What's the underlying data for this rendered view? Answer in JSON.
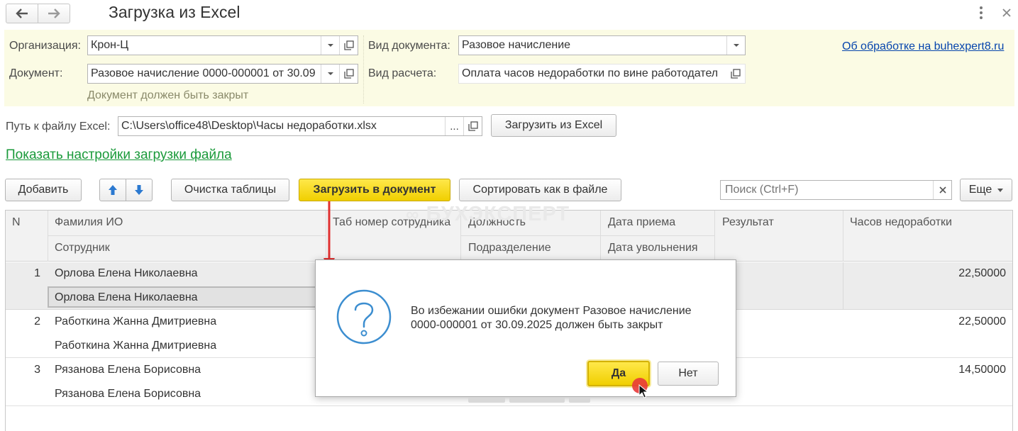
{
  "window": {
    "title": "Загрузка из Excel"
  },
  "form": {
    "org_label": "Организация:",
    "org_value": "Крон-Ц",
    "doc_label": "Документ:",
    "doc_value": "Разовое начисление 0000-000001 от 30.09",
    "doc_hint": "Документ должен быть закрыт",
    "doctype_label": "Вид документа:",
    "doctype_value": "Разовое начисление",
    "calc_label": "Вид расчета:",
    "calc_value": "Оплата часов недоработки по вине работодател",
    "about_link": "Об обработке на buhexpert8.ru"
  },
  "file": {
    "path_label": "Путь к файлу Excel:",
    "path_value": "C:\\Users\\office48\\Desktop\\Часы недоработки.xlsx",
    "ellipsis": "...",
    "load_button": "Загрузить из Excel",
    "settings_link": "Показать настройки загрузки файла"
  },
  "toolbar": {
    "add": "Добавить",
    "clear": "Очистка таблицы",
    "load_doc": "Загрузить в документ",
    "sort": "Сортировать как в файле",
    "search_placeholder": "Поиск (Ctrl+F)",
    "more": "Еще"
  },
  "watermark": "БУХЭКСПЕРТ",
  "table": {
    "headers": {
      "n": "N",
      "fio": "Фамилия ИО",
      "employee": "Сотрудник",
      "tab_no": "Таб номер сотрудника",
      "position": "Должность",
      "department": "Подразделение",
      "hire_date": "Дата приема",
      "fire_date": "Дата увольнения",
      "result": "Результат",
      "hours": "Часов недоработки"
    },
    "rows": [
      {
        "n": "1",
        "fio": "Орлова Елена Николаевна",
        "employee": "Орлова Елена Николаевна",
        "hours": "22,50000"
      },
      {
        "n": "2",
        "fio": "Работкина Жанна Дмитриевна",
        "employee": "Работкина Жанна Дмитриевна",
        "hours": "22,50000"
      },
      {
        "n": "3",
        "fio": "Рязанова Елена Борисовна",
        "employee": "Рязанова Елена Борисовна",
        "hours": "14,50000"
      }
    ]
  },
  "dialog": {
    "message_line1": "Во избежании ошибки документ Разовое начисление",
    "message_line2": "0000-000001 от 30.09.2025 должен быть закрыт",
    "yes": "Да",
    "no": "Нет"
  },
  "colors": {
    "accent_yellow": "#f5d800",
    "form_bg": "#fbfbe4",
    "link_green": "#1a9a3a",
    "link_blue": "#0645ad",
    "arrow_red": "#e03030"
  }
}
